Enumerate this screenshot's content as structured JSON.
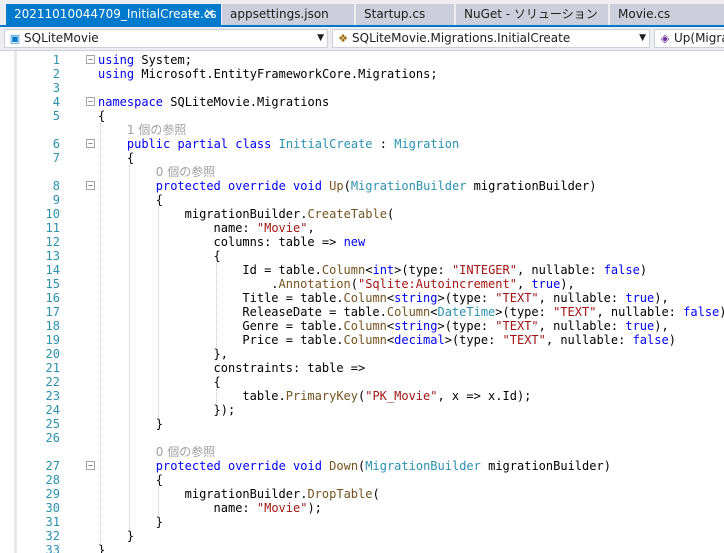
{
  "tabs": [
    {
      "label": "20211010044709_InitialCreate.cs",
      "active": true,
      "pin": "⊣",
      "close": "✕"
    },
    {
      "label": "appsettings.json",
      "active": false
    },
    {
      "label": "Startup.cs",
      "active": false
    },
    {
      "label": "NuGet - ソリューション",
      "active": false
    },
    {
      "label": "Movie.cs",
      "active": false
    }
  ],
  "nav": {
    "project": "SQLiteMovie",
    "type": "SQLiteMovie.Migrations.InitialCreate",
    "member": "Up(MigrationBuilder"
  },
  "lens": {
    "refs1": "1 個の参照",
    "refs0": "0 個の参照"
  },
  "colors": {
    "accent": "#007ACC",
    "keyword": "#0000FF",
    "type": "#2B91AF",
    "string": "#A31515",
    "method": "#74531F",
    "line_number": "#2B91AF"
  },
  "code": {
    "lines": [
      {
        "n": "1",
        "t": [
          [
            "kw",
            "using"
          ],
          [
            "",
            "System;"
          ]
        ]
      },
      {
        "n": "2",
        "t": [
          [
            "kw",
            "using"
          ],
          [
            "",
            "Microsoft.EntityFrameworkCore.Migrations;"
          ]
        ]
      },
      {
        "n": "3",
        "t": []
      },
      {
        "n": "4",
        "t": [
          [
            "kw",
            "namespace"
          ],
          [
            "",
            "SQLiteMovie.Migrations"
          ]
        ]
      },
      {
        "n": "5",
        "t": [
          [
            "",
            "{"
          ]
        ]
      },
      {
        "n": "6",
        "t": [
          [
            "kw",
            "public partial class"
          ],
          [
            "ty",
            "InitialCreate"
          ],
          [
            "",
            " : "
          ],
          [
            "ty",
            "Migration"
          ]
        ]
      },
      {
        "n": "7",
        "t": [
          [
            "",
            "{"
          ]
        ]
      },
      {
        "n": "8",
        "t": [
          [
            "kw",
            "protected override void"
          ],
          [
            "mt",
            "Up"
          ],
          [
            "",
            "("
          ],
          [
            "ty",
            "MigrationBuilder"
          ],
          [
            "",
            " migrationBuilder)"
          ]
        ]
      },
      {
        "n": "9",
        "t": [
          [
            "",
            "{"
          ]
        ]
      },
      {
        "n": "10",
        "t": [
          [
            "",
            "migrationBuilder."
          ],
          [
            "mt",
            "CreateTable"
          ],
          [
            "",
            "("
          ]
        ]
      },
      {
        "n": "11",
        "t": [
          [
            "",
            "name: "
          ],
          [
            "st",
            "\"Movie\""
          ],
          [
            "",
            ","
          ]
        ]
      },
      {
        "n": "12",
        "t": [
          [
            "",
            "columns: table => "
          ],
          [
            "kw",
            "new"
          ]
        ]
      },
      {
        "n": "13",
        "t": [
          [
            "",
            "{"
          ]
        ]
      },
      {
        "n": "14",
        "t": [
          [
            "",
            "Id = table."
          ],
          [
            "mt",
            "Column"
          ],
          [
            "",
            "<"
          ],
          [
            "kw",
            "int"
          ],
          [
            "",
            ">(type: "
          ],
          [
            "st",
            "\"INTEGER\""
          ],
          [
            "",
            ", nullable: "
          ],
          [
            "kw",
            "false"
          ],
          [
            "",
            ")"
          ]
        ]
      },
      {
        "n": "15",
        "t": [
          [
            "",
            "."
          ],
          [
            "mt",
            "Annotation"
          ],
          [
            "",
            "("
          ],
          [
            "st",
            "\"Sqlite:Autoincrement\""
          ],
          [
            "",
            ", "
          ],
          [
            "kw",
            "true"
          ],
          [
            "",
            "),"
          ]
        ]
      },
      {
        "n": "16",
        "t": [
          [
            "",
            "Title = table."
          ],
          [
            "mt",
            "Column"
          ],
          [
            "",
            "<"
          ],
          [
            "kw",
            "string"
          ],
          [
            "",
            ">(type: "
          ],
          [
            "st",
            "\"TEXT\""
          ],
          [
            "",
            ", nullable: "
          ],
          [
            "kw",
            "true"
          ],
          [
            "",
            "),"
          ]
        ]
      },
      {
        "n": "17",
        "t": [
          [
            "",
            "ReleaseDate = table."
          ],
          [
            "mt",
            "Column"
          ],
          [
            "",
            "<"
          ],
          [
            "ty",
            "DateTime"
          ],
          [
            "",
            ">(type: "
          ],
          [
            "st",
            "\"TEXT\""
          ],
          [
            "",
            ", nullable: "
          ],
          [
            "kw",
            "false"
          ],
          [
            "",
            "),"
          ]
        ]
      },
      {
        "n": "18",
        "t": [
          [
            "",
            "Genre = table."
          ],
          [
            "mt",
            "Column"
          ],
          [
            "",
            "<"
          ],
          [
            "kw",
            "string"
          ],
          [
            "",
            ">(type: "
          ],
          [
            "st",
            "\"TEXT\""
          ],
          [
            "",
            ", nullable: "
          ],
          [
            "kw",
            "true"
          ],
          [
            "",
            "),"
          ]
        ]
      },
      {
        "n": "19",
        "t": [
          [
            "",
            "Price = table."
          ],
          [
            "mt",
            "Column"
          ],
          [
            "",
            "<"
          ],
          [
            "kw",
            "decimal"
          ],
          [
            "",
            ">(type: "
          ],
          [
            "st",
            "\"TEXT\""
          ],
          [
            "",
            ", nullable: "
          ],
          [
            "kw",
            "false"
          ],
          [
            "",
            ")"
          ]
        ]
      },
      {
        "n": "20",
        "t": [
          [
            "",
            "},"
          ]
        ]
      },
      {
        "n": "21",
        "t": [
          [
            "",
            "constraints: table =>"
          ]
        ]
      },
      {
        "n": "22",
        "t": [
          [
            "",
            "{"
          ]
        ]
      },
      {
        "n": "23",
        "t": [
          [
            "",
            "table."
          ],
          [
            "mt",
            "PrimaryKey"
          ],
          [
            "",
            "("
          ],
          [
            "st",
            "\"PK_Movie\""
          ],
          [
            "",
            ", x => x.Id);"
          ]
        ]
      },
      {
        "n": "24",
        "t": [
          [
            "",
            "});"
          ]
        ]
      },
      {
        "n": "25",
        "t": [
          [
            "",
            "}"
          ]
        ]
      },
      {
        "n": "26",
        "t": []
      },
      {
        "n": "27",
        "t": [
          [
            "kw",
            "protected override void"
          ],
          [
            "mt",
            "Down"
          ],
          [
            "",
            "("
          ],
          [
            "ty",
            "MigrationBuilder"
          ],
          [
            "",
            " migrationBuilder)"
          ]
        ]
      },
      {
        "n": "28",
        "t": [
          [
            "",
            "{"
          ]
        ]
      },
      {
        "n": "29",
        "t": [
          [
            "",
            "migrationBuilder."
          ],
          [
            "mt",
            "DropTable"
          ],
          [
            "",
            "("
          ]
        ]
      },
      {
        "n": "30",
        "t": [
          [
            "",
            "name: "
          ],
          [
            "st",
            "\"Movie\""
          ],
          [
            "",
            ");"
          ]
        ]
      },
      {
        "n": "31",
        "t": [
          [
            "",
            "}"
          ]
        ]
      },
      {
        "n": "32",
        "t": [
          [
            "",
            "}"
          ]
        ]
      },
      {
        "n": "33",
        "t": [
          [
            "",
            "}"
          ]
        ]
      }
    ]
  }
}
